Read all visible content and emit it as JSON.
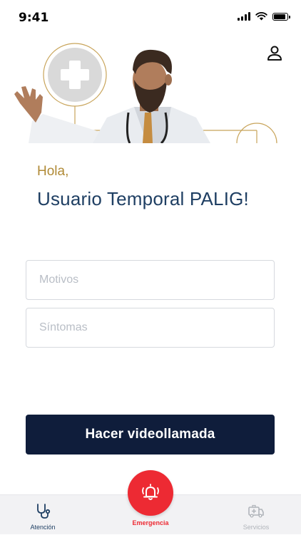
{
  "status_bar": {
    "time": "9:41"
  },
  "greeting": {
    "hola": "Hola,",
    "name": "Usuario Temporal PALIG!"
  },
  "form": {
    "motivos_placeholder": "Motivos",
    "motivos_value": "",
    "sintomas_placeholder": "Síntomas",
    "sintomas_value": ""
  },
  "cta": {
    "label": "Hacer videollamada"
  },
  "bottom_nav": {
    "atencion_label": "Atención",
    "emergencia_label": "Emergencia",
    "servicios_label": "Servicios"
  },
  "icons": {
    "profile": "person-icon",
    "atencion": "stethoscope-icon",
    "emergencia": "alarm-bell-icon",
    "servicios": "ambulance-icon"
  },
  "colors": {
    "primary_dark": "#0f1d3b",
    "title_blue": "#1f3f63",
    "accent_gold": "#b08a36",
    "emergency_red": "#ed2a33",
    "inactive_gray": "#b0b4ba"
  }
}
